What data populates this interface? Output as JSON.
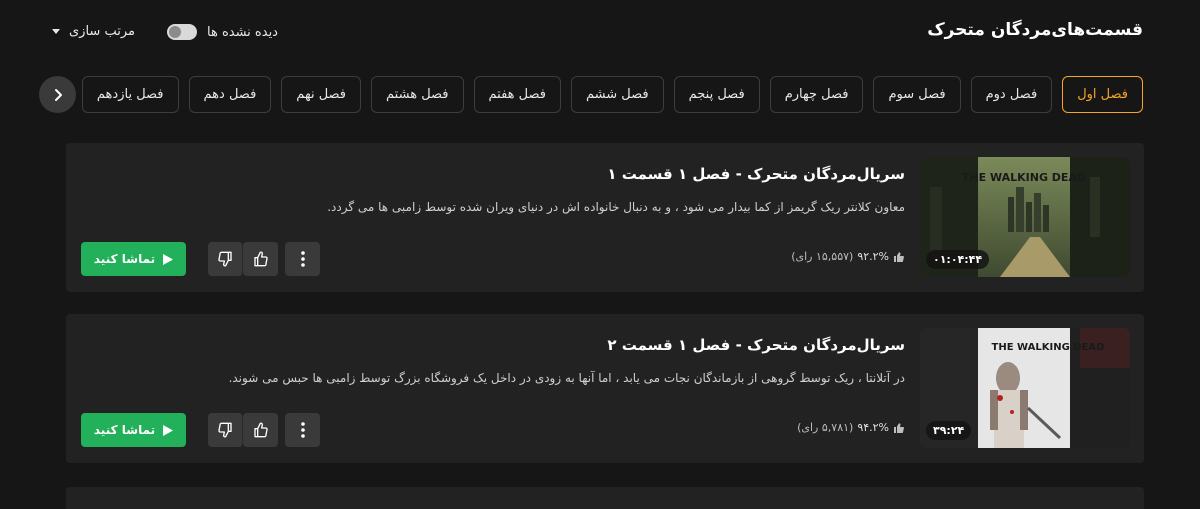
{
  "header": {
    "title": "قسمت‌های‌مردگان متحرک",
    "unseen_label": "دیده نشده ها",
    "sort_label": "مرتب سازی"
  },
  "seasons": [
    {
      "label": "فصل اول",
      "active": true
    },
    {
      "label": "فصل دوم"
    },
    {
      "label": "فصل سوم"
    },
    {
      "label": "فصل چهارم"
    },
    {
      "label": "فصل پنجم"
    },
    {
      "label": "فصل ششم"
    },
    {
      "label": "فصل هفتم"
    },
    {
      "label": "فصل هشتم"
    },
    {
      "label": "فصل نهم"
    },
    {
      "label": "فصل دهم"
    },
    {
      "label": "فصل یازدهم"
    }
  ],
  "episodes": [
    {
      "title": "سریال‌مردگان متحرک - فصل ۱ قسمت ۱",
      "description": "معاون کلانتر ریک گریمز از کما بیدار می شود ، و به دنبال خانواده اش در دنیای ویران شده توسط زامبی ها می گردد.",
      "rating_pct": "۹۲.۲%",
      "votes": "(۱۵,۵۵۷ رای)",
      "duration": "۰۱:۰۴:۴۴",
      "poster_text": "THE WALKING DEAD",
      "watch_label": "تماشا کنید"
    },
    {
      "title": "سریال‌مردگان متحرک - فصل ۱ قسمت ۲",
      "description": "در آتلانتا ، ریک توسط گروهی از بازماندگان نجات می یابد ، اما آنها به زودی در داخل یک فروشگاه بزرگ توسط زامبی ها حبس می شوند.",
      "rating_pct": "۹۴.۲%",
      "votes": "(۵,۷۸۱ رای)",
      "duration": "۳۹:۲۴",
      "poster_text": "THE WALKING DEAD",
      "watch_label": "تماشا کنید"
    }
  ],
  "colors": {
    "accent": "#f5a623",
    "watch_button": "#23b05a",
    "background": "#161616",
    "card": "#222222"
  }
}
